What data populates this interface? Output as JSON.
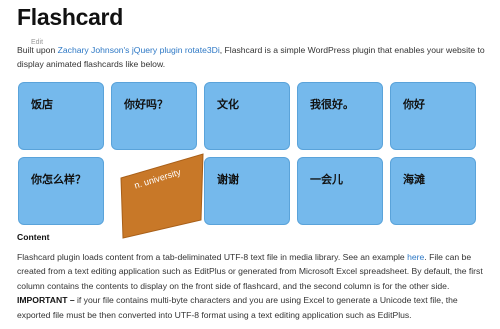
{
  "page": {
    "title": "Flashcard",
    "edit_label": "Edit"
  },
  "intro": {
    "prefix": "Built upon ",
    "link_text": "Zachary Johnson's jQuery plugin rotate3Di",
    "suffix": ", Flashcard is a simple WordPress plugin that enables your website to display animated flashcards like below."
  },
  "flashcards": {
    "row1": [
      "饭店",
      "你好吗？",
      "文化",
      "我很好。",
      "你好"
    ],
    "row2_first": "你怎么样？",
    "flipped_card_text": "n. university",
    "row2_rest": [
      "谢谢",
      "一会儿",
      "海滩"
    ],
    "card_color": "#75b9ec",
    "flipped_color": "#c87828"
  },
  "content": {
    "heading": "Content",
    "p1_prefix": "Flashcard plugin loads content from a tab-deliminated UTF-8 text file in media library. See an example ",
    "p1_link": "here",
    "p1_suffix": ". File can be created from a text editing application such as EditPlus or generated from Microsoft Excel spreadsheet. By default, the first column contains the contents to display on the front side of flashcard, and the second column is for the other side.",
    "important_label": "IMPORTANT –",
    "important_text": " if your file contains multi-byte characters and you are using Excel to generate a Unicode text file, the exported file must be then converted into UTF-8 format using a text editing application such as EditPlus."
  }
}
